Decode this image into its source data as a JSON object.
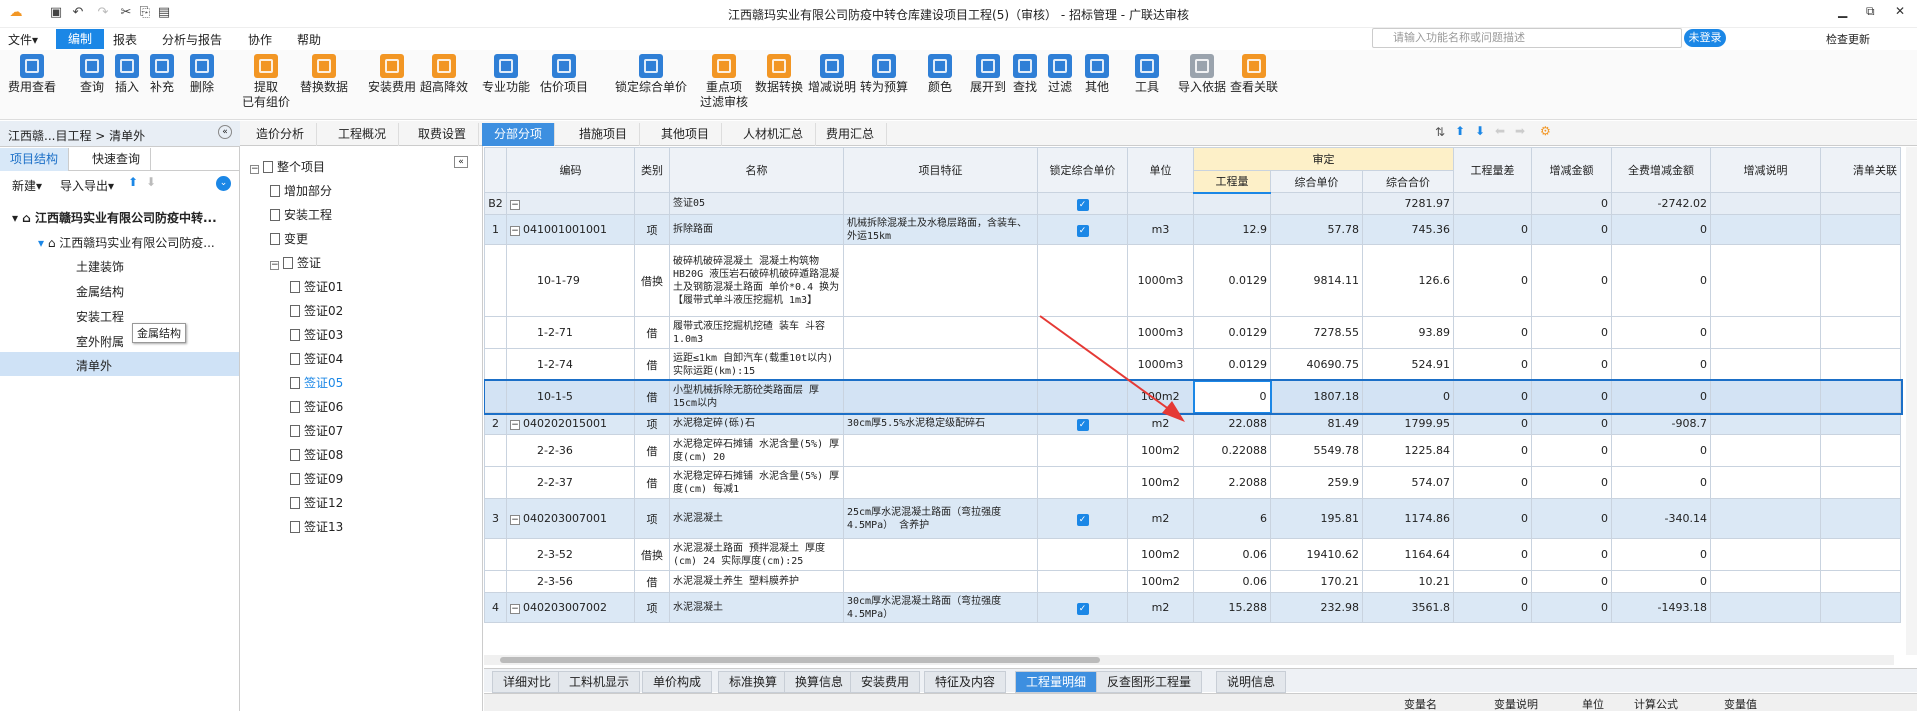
{
  "window": {
    "title": "江西赣玛实业有限公司防疫中转仓库建设项目工程(5)（审核） - 招标管理 - 广联达审核",
    "controls": [
      "▁",
      "⧉",
      "✕"
    ]
  },
  "menu": {
    "items": [
      "文件▾",
      "编制",
      "报表",
      "分析与报告",
      "协作",
      "帮助"
    ],
    "search_placeholder": "请输入功能名称或问题描述",
    "login": "未登录",
    "check_update": "检查更新"
  },
  "ribbon": [
    {
      "label": "费用查看",
      "color": "blue"
    },
    {
      "label": "查询",
      "color": "blue"
    },
    {
      "label": "插入",
      "color": "blue"
    },
    {
      "label": "补充",
      "color": "blue"
    },
    {
      "label": "删除",
      "color": "blue"
    },
    {
      "label": "提取",
      "label2": "已有组价",
      "color": "orange"
    },
    {
      "label": "替换数据",
      "color": "orange"
    },
    {
      "label": "安装费用",
      "color": "orange"
    },
    {
      "label": "超高降效",
      "color": "orange"
    },
    {
      "label": "专业功能",
      "color": "blue"
    },
    {
      "label": "估价项目",
      "color": "blue"
    },
    {
      "label": "锁定综合单价",
      "color": "blue"
    },
    {
      "label": "重点项",
      "label2": "过滤审核",
      "color": "orange"
    },
    {
      "label": "数据转换",
      "color": "orange"
    },
    {
      "label": "增减说明",
      "color": "blue"
    },
    {
      "label": "转为预算",
      "color": "blue"
    },
    {
      "label": "颜色",
      "color": "blue"
    },
    {
      "label": "展开到",
      "color": "blue"
    },
    {
      "label": "查找",
      "color": "blue"
    },
    {
      "label": "过滤",
      "color": "blue"
    },
    {
      "label": "其他",
      "color": "blue"
    },
    {
      "label": "工具",
      "color": "blue"
    },
    {
      "label": "导入依据",
      "color": "gray"
    },
    {
      "label": "查看关联",
      "color": "orange"
    }
  ],
  "left": {
    "breadcrumb": "江西赣...目工程 > 清单外",
    "tabs": [
      "项目结构",
      "快速查询"
    ],
    "new": "新建▾",
    "import": "导入导出▾",
    "tree": [
      "江西赣玛实业有限公司防疫中转...",
      "江西赣玛实业有限公司防疫...",
      "土建装饰",
      "金属结构",
      "安装工程",
      "室外附属",
      "清单外"
    ],
    "tooltip": "金属结构"
  },
  "mid": {
    "items": [
      "整个项目",
      "增加部分",
      "安装工程",
      "变更",
      "签证",
      "签证01",
      "签证02",
      "签证03",
      "签证04",
      "签证05",
      "签证06",
      "签证07",
      "签证08",
      "签证09",
      "签证12",
      "签证13"
    ]
  },
  "maintabs": [
    "造价分析",
    "工程概况",
    "取费设置",
    "分部分项",
    "措施项目",
    "其他项目",
    "人材机汇总",
    "费用汇总"
  ],
  "grid": {
    "headers": {
      "code": "编码",
      "type": "类别",
      "name": "名称",
      "feature": "项目特征",
      "lock": "锁定综合单价",
      "unit": "单位",
      "audit": "审定",
      "qty": "工程量",
      "unitprice": "综合单价",
      "total": "综合合价",
      "qtydiff": "工程量差",
      "incr": "增减金额",
      "allincr": "全费增减金额",
      "note": "增减说明",
      "link": "清单关联"
    },
    "rows": [
      {
        "no": "B2",
        "code": "",
        "type": "",
        "name": "签证05",
        "feature": "",
        "lock": true,
        "unit": "",
        "qty": "",
        "price": "",
        "total": "7281.97",
        "diff": "",
        "inc": "0",
        "all": "-2742.02",
        "cls": "sec"
      },
      {
        "no": "1",
        "code": "041001001001",
        "type": "项",
        "name": "拆除路面",
        "feature": "机械拆除混凝土及水稳层路面，含装车、外运15km",
        "lock": true,
        "unit": "m3",
        "qty": "12.9",
        "price": "57.78",
        "total": "745.36",
        "diff": "0",
        "inc": "0",
        "all": "0",
        "cls": "item"
      },
      {
        "no": "",
        "code": "10-1-79",
        "type": "借换",
        "name": "破碎机破碎混凝土 混凝土构筑物 HB20G 液压岩石破碎机破碎遁路混凝土及钢筋混凝土路面 单价*0.4 换为【履带式单斗液压挖掘机 1m3】",
        "feature": "",
        "lock": false,
        "unit": "1000m3",
        "qty": "0.0129",
        "price": "9814.11",
        "total": "126.6",
        "diff": "0",
        "inc": "0",
        "all": "0",
        "cls": ""
      },
      {
        "no": "",
        "code": "1-2-71",
        "type": "借",
        "name": "履带式液压挖掘机挖碴 装车 斗容1.0m3",
        "feature": "",
        "lock": false,
        "unit": "1000m3",
        "qty": "0.0129",
        "price": "7278.55",
        "total": "93.89",
        "diff": "0",
        "inc": "0",
        "all": "0",
        "cls": ""
      },
      {
        "no": "",
        "code": "1-2-74",
        "type": "借",
        "name": "运距≤1km 自卸汽车(载重10t以内) 实际运距(km):15",
        "feature": "",
        "lock": false,
        "unit": "1000m3",
        "qty": "0.0129",
        "price": "40690.75",
        "total": "524.91",
        "diff": "0",
        "inc": "0",
        "all": "0",
        "cls": ""
      },
      {
        "no": "",
        "code": "10-1-5",
        "type": "借",
        "name": "小型机械拆除无筋砼类路面层 厚15cm以内",
        "feature": "",
        "lock": false,
        "unit": "100m2",
        "qty": "0",
        "price": "1807.18",
        "total": "0",
        "diff": "0",
        "inc": "0",
        "all": "0",
        "cls": "sel"
      },
      {
        "no": "2",
        "code": "040202015001",
        "type": "项",
        "name": "水泥稳定碎(砾)石",
        "feature": "30cm厚5.5%水泥稳定级配碎石",
        "lock": true,
        "unit": "m2",
        "qty": "22.088",
        "price": "81.49",
        "total": "1799.95",
        "diff": "0",
        "inc": "0",
        "all": "-908.7",
        "cls": "item"
      },
      {
        "no": "",
        "code": "2-2-36",
        "type": "借",
        "name": "水泥稳定碎石摊铺 水泥含量(5%) 厚度(cm) 20",
        "feature": "",
        "lock": false,
        "unit": "100m2",
        "qty": "0.22088",
        "price": "5549.78",
        "total": "1225.84",
        "diff": "0",
        "inc": "0",
        "all": "0",
        "cls": ""
      },
      {
        "no": "",
        "code": "2-2-37",
        "type": "借",
        "name": "水泥稳定碎石摊铺 水泥含量(5%) 厚度(cm) 每减1",
        "feature": "",
        "lock": false,
        "unit": "100m2",
        "qty": "2.2088",
        "price": "259.9",
        "total": "574.07",
        "diff": "0",
        "inc": "0",
        "all": "0",
        "cls": ""
      },
      {
        "no": "3",
        "code": "040203007001",
        "type": "项",
        "name": "水泥混凝土",
        "feature": "25cm厚水泥混凝土路面（弯拉强度4.5MPa） 含养护",
        "lock": true,
        "unit": "m2",
        "qty": "6",
        "price": "195.81",
        "total": "1174.86",
        "diff": "0",
        "inc": "0",
        "all": "-340.14",
        "cls": "item"
      },
      {
        "no": "",
        "code": "2-3-52",
        "type": "借换",
        "name": "水泥混凝土路面 预拌混凝土 厚度(cm) 24 实际厚度(cm):25",
        "feature": "",
        "lock": false,
        "unit": "100m2",
        "qty": "0.06",
        "price": "19410.62",
        "total": "1164.64",
        "diff": "0",
        "inc": "0",
        "all": "0",
        "cls": ""
      },
      {
        "no": "",
        "code": "2-3-56",
        "type": "借",
        "name": "水泥混凝土养生 塑料膜养护",
        "feature": "",
        "lock": false,
        "unit": "100m2",
        "qty": "0.06",
        "price": "170.21",
        "total": "10.21",
        "diff": "0",
        "inc": "0",
        "all": "0",
        "cls": ""
      },
      {
        "no": "4",
        "code": "040203007002",
        "type": "项",
        "name": "水泥混凝土",
        "feature": "30cm厚水泥混凝土路面（弯拉强度4.5MPa）",
        "lock": true,
        "unit": "m2",
        "qty": "15.288",
        "price": "232.98",
        "total": "3561.8",
        "diff": "0",
        "inc": "0",
        "all": "-1493.18",
        "cls": "item"
      }
    ]
  },
  "bottomtabs": [
    "详细对比",
    "工料机显示",
    "单价构成",
    "标准换算",
    "换算信息",
    "安装费用",
    "特征及内容",
    "工程量明细",
    "反查图形工程量",
    "说明信息"
  ],
  "bottomhdr": [
    "变量名",
    "变量说明",
    "单位",
    "计算公式",
    "变量值"
  ]
}
